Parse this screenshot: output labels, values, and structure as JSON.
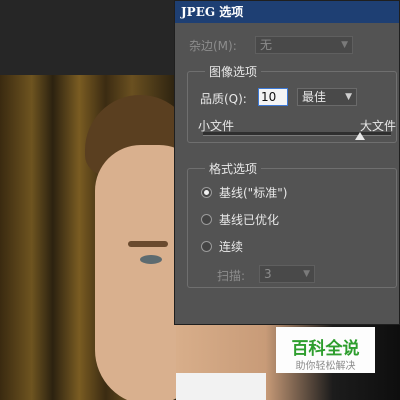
{
  "dialog": {
    "title": "JPEG 选项",
    "matte": {
      "label": "杂边(M):",
      "value": "无"
    },
    "image_options": {
      "title": "图像选项",
      "quality_label": "品质(Q):",
      "quality_value": "10",
      "quality_preset": "最佳",
      "small_file_label": "小文件",
      "large_file_label": "大文件",
      "quality_level_fraction": 0.83
    },
    "format_options": {
      "title": "格式选项",
      "options": [
        {
          "label": "基线(\"标准\")",
          "selected": true
        },
        {
          "label": "基线已优化",
          "selected": false
        },
        {
          "label": "连续",
          "selected": false
        }
      ],
      "scans_label": "扫描:",
      "scans_value": "3"
    }
  },
  "watermark": {
    "title": "百科全说",
    "subtitle": "助你轻松解决"
  },
  "colors": {
    "titlebar": "#1e3f73",
    "dialog_bg": "#535353",
    "watermark_green": "#2e9e2e"
  },
  "icons": [
    "chevron-down-icon",
    "radio-selected-icon",
    "radio-unselected-icon",
    "slider-thumb-icon"
  ]
}
